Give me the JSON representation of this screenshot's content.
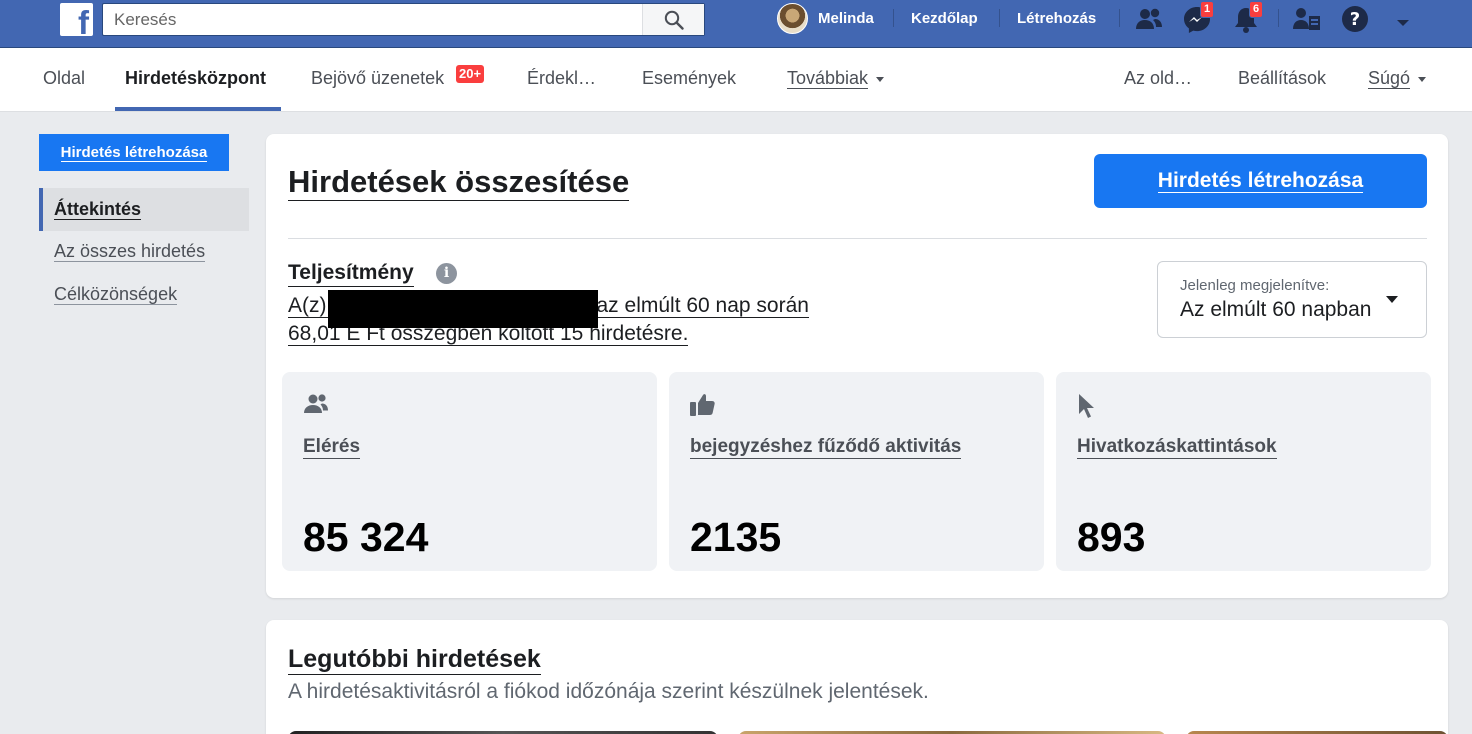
{
  "topbar": {
    "search_placeholder": "Keresés",
    "user_name": "Melinda",
    "home_label": "Kezdőlap",
    "create_label": "Létrehozás",
    "messenger_badge": "1",
    "notifications_badge": "6"
  },
  "pagenav": {
    "items": [
      "Oldal",
      "Hirdetésközpont",
      "Bejövő üzenetek",
      "Érdekl…",
      "Események",
      "Továbbiak"
    ],
    "inbox_badge": "20+",
    "right_items": [
      "Az old…",
      "Beállítások",
      "Súgó"
    ]
  },
  "sidebar": {
    "create_button": "Hirdetés létrehozása",
    "items": [
      "Áttekintés",
      "Az összes hirdetés",
      "Célközönségek"
    ]
  },
  "overview": {
    "title": "Hirdetések összesítése",
    "create_button": "Hirdetés létrehozása",
    "performance_title": "Teljesítmény",
    "info_icon_glyph": "i",
    "desc_line1_prefix": "A(z)",
    "desc_line1_suffix": "az elmúlt 60 nap során",
    "desc_line2": "68,01 E Ft összegben költött 15 hirdetésre.",
    "date_select_label": "Jelenleg megjelenítve:",
    "date_select_value": "Az elmúlt 60 napban"
  },
  "metrics": [
    {
      "icon": "people-icon",
      "label": "Elérés",
      "value": "85 324"
    },
    {
      "icon": "thumbs-up-icon",
      "label": "bejegyzéshez fűződő aktivitás",
      "value": "2135"
    },
    {
      "icon": "cursor-icon",
      "label": "Hivatkozáskattintások",
      "value": "893"
    }
  ],
  "recent": {
    "title": "Legutóbbi hirdetések",
    "subtitle": "A hirdetésaktivitásról a fiókod időzónája szerint készülnek jelentések."
  },
  "colors": {
    "brand": "#4267b2",
    "primary_button": "#1877f2",
    "badge": "#fa3e3e"
  }
}
